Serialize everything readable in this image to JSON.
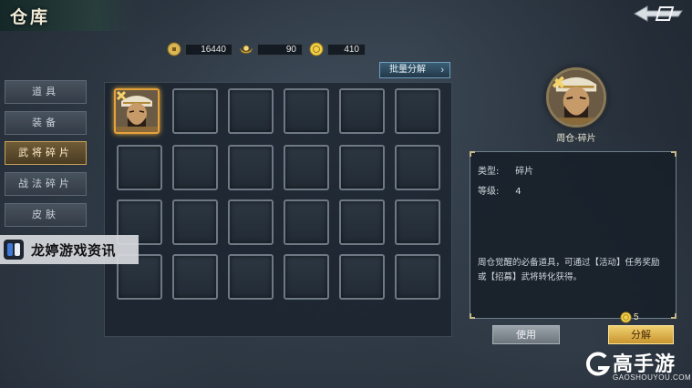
{
  "title": "仓库",
  "currencies": [
    {
      "icon": "copper-coin-icon",
      "value": "16440"
    },
    {
      "icon": "gold-ingot-icon",
      "value": "90"
    },
    {
      "icon": "gold-coin-icon",
      "value": "410"
    }
  ],
  "batch_button": {
    "label": "批量分解",
    "icon": "chevron-right-icon"
  },
  "tabs": [
    {
      "label": "道具",
      "active": false
    },
    {
      "label": "装备",
      "active": false
    },
    {
      "label": "武将碎片",
      "active": true
    },
    {
      "label": "战法碎片",
      "active": false
    },
    {
      "label": "皮肤",
      "active": false
    }
  ],
  "inventory": {
    "rows": 4,
    "cols": 6,
    "items": [
      {
        "name": "周仓-碎片",
        "icon": "general-portrait-icon"
      }
    ]
  },
  "watermark": {
    "text": "龙婷游戏资讯"
  },
  "detail": {
    "name": "周仓-碎片",
    "type_label": "类型:",
    "type_value": "碎片",
    "level_label": "等级:",
    "level_value": "4",
    "description_line1": "周仓觉醒的必备道具，可通过【活动】任务奖励",
    "description_line2": "或【招募】武将转化获得。"
  },
  "actions": {
    "use_label": "使用",
    "decompose_label": "分解",
    "decompose_cost": "5"
  },
  "brand": {
    "cn": "高手游",
    "en": "GAOSHOUYOU.COM"
  }
}
